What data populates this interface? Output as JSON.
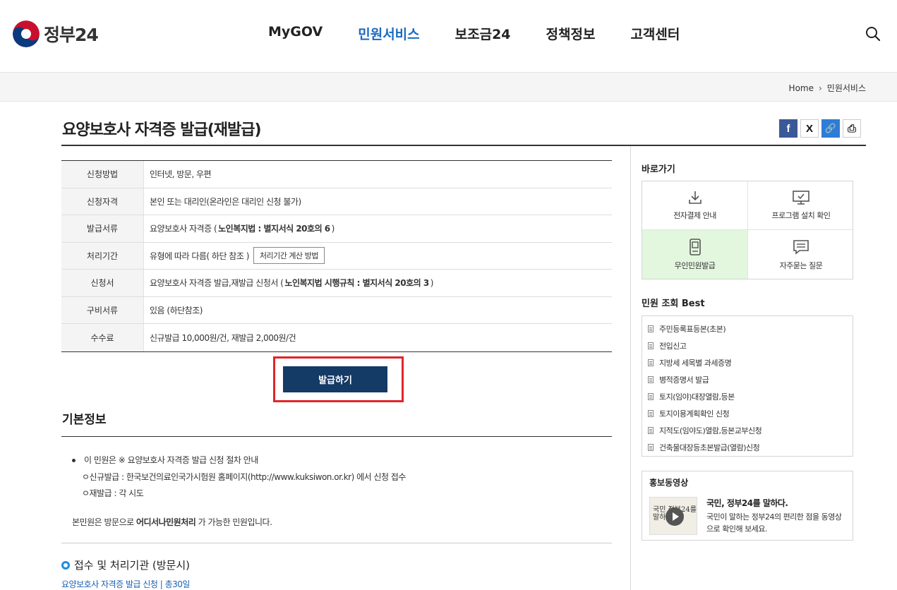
{
  "header": {
    "logo_text": "정부24",
    "nav": [
      "MyGOV",
      "민원서비스",
      "보조금24",
      "정책정보",
      "고객센터"
    ],
    "active_nav": "민원서비스",
    "search_icon": "search-icon"
  },
  "breadcrumb": {
    "home": "Home",
    "current": "민원서비스"
  },
  "page": {
    "title": "요양보호사 자격증 발급(재발급)"
  },
  "share": {
    "facebook": "f",
    "x": "X",
    "link": "🔗",
    "print": "⎙"
  },
  "info_table": {
    "rows": [
      {
        "label": "신청방법",
        "value": "인터넷, 방문, 우편"
      },
      {
        "label": "신청자격",
        "value": "본인 또는 대리인(온라인은 대리인 신청 불가)"
      },
      {
        "label": "발급서류",
        "value": "요양보호사 자격증 (",
        "bold": "노인복지법 : 별지서식 20호의 6",
        "suffix": ")"
      },
      {
        "label": "처리기간",
        "value": "유형에 따라 다름( 하단 참조 )",
        "button": "처리기간 계산 방법"
      },
      {
        "label": "신청서",
        "value": "요양보호사 자격증 발급,재발급 신청서 (",
        "bold": "노인복지법 시행규칙 : 별지서식 20호의 3",
        "suffix": ")"
      },
      {
        "label": "구비서류",
        "value": "있음 (하단참조)"
      },
      {
        "label": "수수료",
        "value": "신규발급 10,000원/건, 재발급 2,000원/건"
      }
    ]
  },
  "apply_button": "발급하기",
  "basic_info": {
    "title": "기본정보",
    "bullet": "이 민원은 ※ 요양보호사 자격증 발급 신청 절차 안내",
    "sub1": "ㅇ신규발급 : 한국보건의료인국가시험원 홈페이지(http://www.kuksiwon.or.kr) 에서 신청 접수",
    "sub2": "ㅇ재발급 : 각 시도",
    "visit_prefix": "본민원은 방문으로 ",
    "visit_bold": "어디서나민원처리",
    "visit_suffix": " 가 가능한 민원입니다.",
    "org_title": "접수 및 처리기관 (방문시)",
    "org_link": "요양보호사 자격증 발급 신청 | 총30일"
  },
  "sidebar": {
    "quick_title": "바로가기",
    "quick": [
      {
        "label": "전자결제 안내",
        "icon": "download-icon"
      },
      {
        "label": "프로그램 설치 확인",
        "icon": "monitor-check-icon"
      },
      {
        "label": "무인민원발급",
        "icon": "kiosk-icon"
      },
      {
        "label": "자주묻는 질문",
        "icon": "chat-icon"
      }
    ],
    "best_title": "민원 조회 Best",
    "best": [
      "주민등록표등본(초본)",
      "전입신고",
      "지방세 세목별 과세증명",
      "병적증명서 발급",
      "토지(임야)대장열람,등본",
      "토지이용계획확인 신청",
      "지적도(임야도)열람,등본교부신청",
      "건축물대장등초본발급(열람)신청"
    ],
    "promo_title": "홍보동영상",
    "promo_headline": "국민, 정부24를 말하다.",
    "promo_text": "국민이 말하는 정부24의 편리한 점을 동영상으로 확인해 보세요.",
    "promo_thumb_text": "국민 정부24를 말하다"
  },
  "colors": {
    "active_nav": "#1a6bbf",
    "apply_button": "#143a66",
    "highlight_box": "#e0252a",
    "quick_green": "#e3f7df",
    "link_blue": "#1a5fb4"
  }
}
